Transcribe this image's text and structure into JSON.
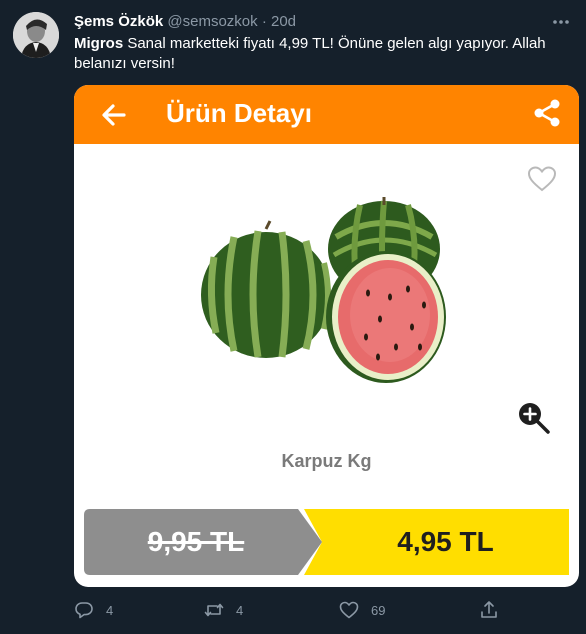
{
  "tweet": {
    "author_name": "Şems Özkök",
    "handle": "@semsozkok",
    "separator": "·",
    "time": "20d",
    "text_bold": "Migros",
    "text": " Sanal marketteki fiyatı 4,99 TL! Önüne gelen algı yapıyor. Allah belanızı versin!"
  },
  "card": {
    "title": "Ürün Detayı",
    "product_name": "Karpuz Kg",
    "old_price": "9,95 TL",
    "new_price": "4,95 TL",
    "colors": {
      "appbar": "#ff8400",
      "old_price_bg": "#8e8e8e",
      "new_price_bg": "#ffde00"
    }
  },
  "actions": {
    "reply_count": "4",
    "retweet_count": "4",
    "like_count": "69"
  },
  "icons": [
    "more-icon",
    "back-arrow-icon",
    "share-icon",
    "heart-outline-icon",
    "zoom-in-icon",
    "reply-icon",
    "retweet-icon",
    "like-icon",
    "share-tweet-icon"
  ]
}
